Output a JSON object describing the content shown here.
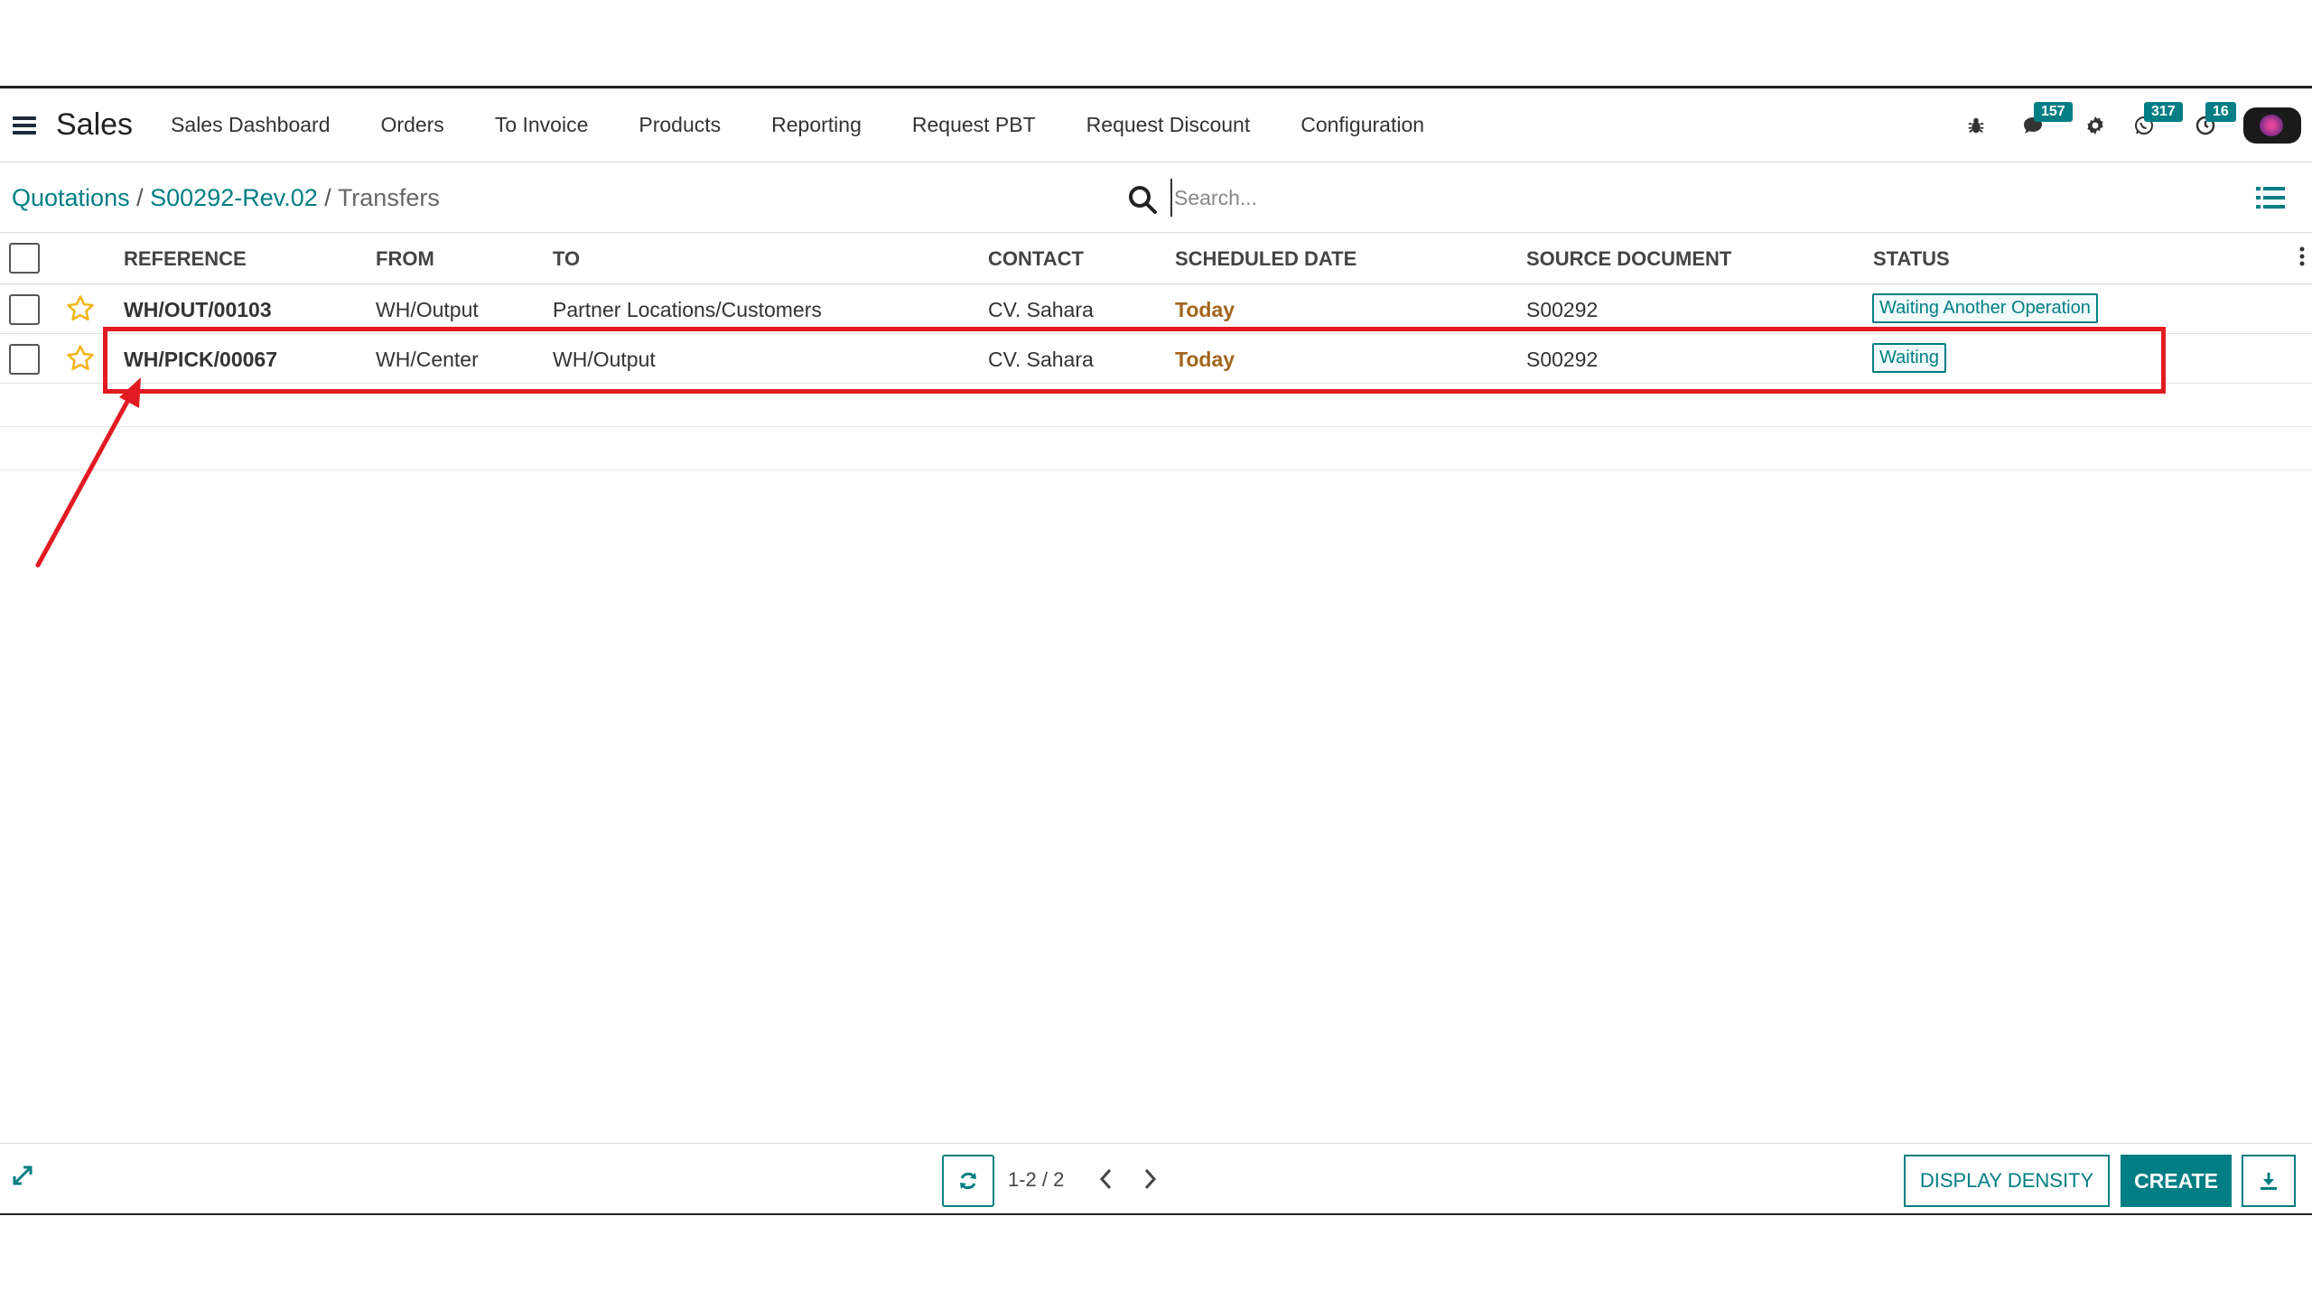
{
  "navbar": {
    "app_title": "Sales",
    "menu": [
      "Sales Dashboard",
      "Orders",
      "To Invoice",
      "Products",
      "Reporting",
      "Request PBT",
      "Request Discount",
      "Configuration"
    ],
    "icons": {
      "bug": "bug-icon",
      "messages": "chat-icon",
      "settings": "gear-icon",
      "whatsapp": "whatsapp-icon",
      "activity": "clock-icon"
    },
    "badges": {
      "messages": "157",
      "whatsapp": "317",
      "activity": "16"
    }
  },
  "breadcrumb": {
    "items": [
      "Quotations",
      "S00292-Rev.02"
    ],
    "separator": "/",
    "current": "Transfers"
  },
  "search": {
    "placeholder": "Search..."
  },
  "table": {
    "headers": [
      "REFERENCE",
      "FROM",
      "TO",
      "CONTACT",
      "SCHEDULED DATE",
      "SOURCE DOCUMENT",
      "STATUS"
    ],
    "rows": [
      {
        "reference": "WH/OUT/00103",
        "from": "WH/Output",
        "to": "Partner Locations/Customers",
        "contact": "CV. Sahara",
        "scheduled": "Today",
        "source": "S00292",
        "status": "Waiting Another Operation"
      },
      {
        "reference": "WH/PICK/00067",
        "from": "WH/Center",
        "to": "WH/Output",
        "contact": "CV. Sahara",
        "scheduled": "Today",
        "source": "S00292",
        "status": "Waiting"
      }
    ]
  },
  "footer": {
    "pager": "1-2 / 2",
    "display_density": "DISPLAY DENSITY",
    "create": "CREATE"
  },
  "colors": {
    "accent": "#017e84",
    "today": "#a2641c",
    "annotation": "#e21b22"
  }
}
